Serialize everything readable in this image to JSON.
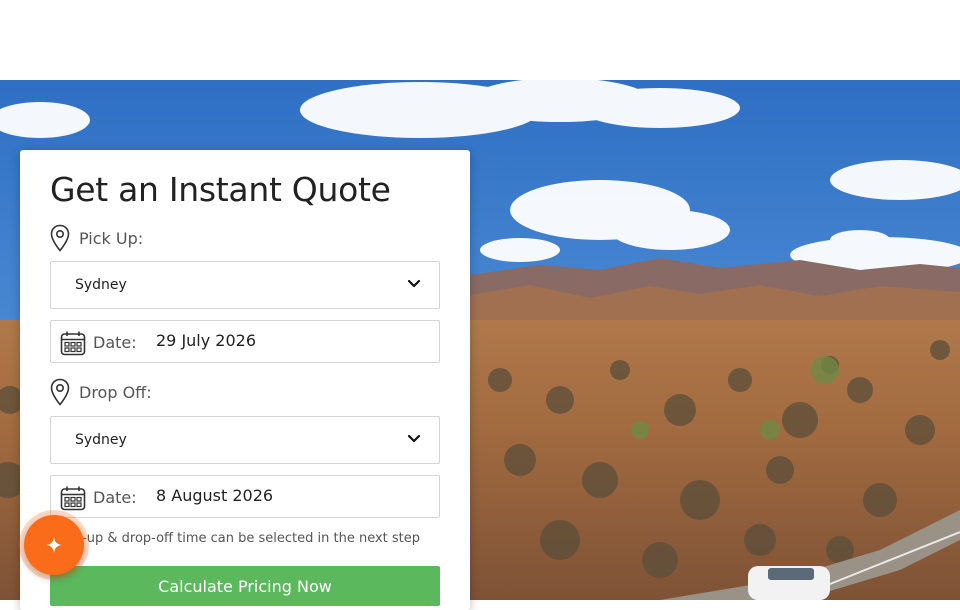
{
  "quote": {
    "title": "Get an Instant Quote",
    "pickup": {
      "label": "Pick Up:",
      "location": "Sydney",
      "date_label": "Date:",
      "date_value": "29 July 2026"
    },
    "dropoff": {
      "label": "Drop Off:",
      "location": "Sydney",
      "date_label": "Date:",
      "date_value": "8 August 2026"
    },
    "hint": "Pick-up & drop-off time can be selected in the next step",
    "submit_label": "Calculate Pricing Now"
  },
  "icons": {
    "location": "map-pin-icon",
    "calendar": "calendar-icon",
    "dropdown": "chevron-down-icon",
    "fab": "sparkle-icon"
  },
  "colors": {
    "primary_button": "#5cb85c",
    "fab": "#fa6c1a",
    "text": "#222222",
    "muted_text": "#555555"
  }
}
